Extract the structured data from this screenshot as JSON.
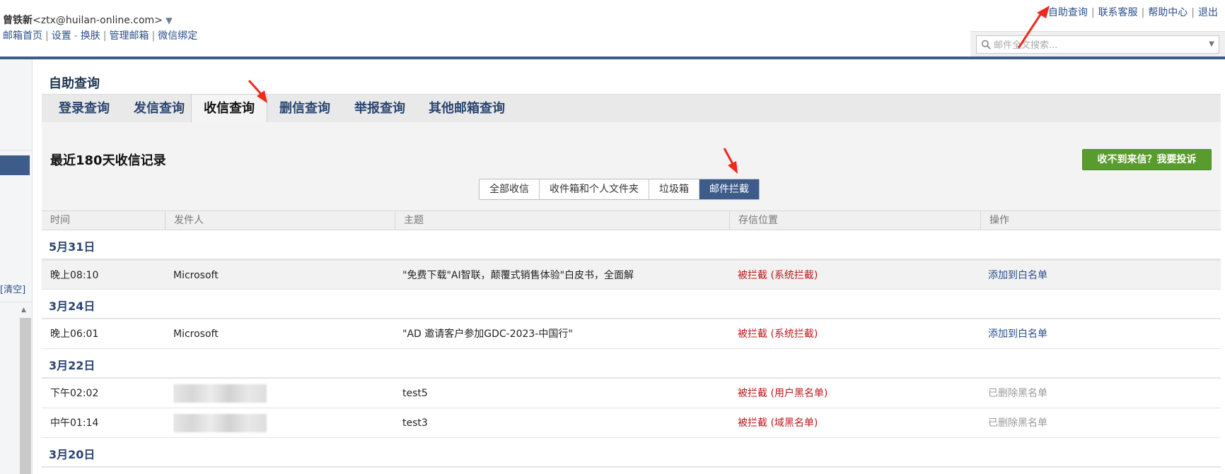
{
  "header": {
    "user_name": "曾铁新",
    "user_email": "<ztx@huilan-online.com>",
    "user_arrow": "▼",
    "links": [
      "邮箱首页",
      "设置",
      "换肤",
      "管理邮箱",
      "微信绑定"
    ],
    "links_seps": [
      "|",
      "-",
      "|",
      "|"
    ],
    "right_links": [
      "自助查询",
      "联系客服",
      "帮助中心",
      "退出"
    ],
    "right_sep": "|",
    "search_placeholder": "邮件全文搜索...",
    "search_caret": "▼"
  },
  "sidebar": {
    "clear_label": "[清空]",
    "scroll_up": "▲"
  },
  "page": {
    "title": "自助查询",
    "tabs": [
      {
        "label": "登录查询",
        "active": false
      },
      {
        "label": "发信查询",
        "active": false
      },
      {
        "label": "收信查询",
        "active": true
      },
      {
        "label": "删信查询",
        "active": false
      },
      {
        "label": "举报查询",
        "active": false
      },
      {
        "label": "其他邮箱查询",
        "active": false
      }
    ],
    "section_title": "最近180天收信记录",
    "complain_button": "收不到来信？我要投诉",
    "filters": [
      {
        "label": "全部收信",
        "active": false
      },
      {
        "label": "收件箱和个人文件夹",
        "active": false
      },
      {
        "label": "垃圾箱",
        "active": false
      },
      {
        "label": "邮件拦截",
        "active": true
      }
    ]
  },
  "table": {
    "columns": [
      "时间",
      "发件人",
      "主题",
      "存信位置",
      "操作"
    ],
    "groups": [
      {
        "date": "5月31日",
        "rows": [
          {
            "time": "晚上08:10",
            "sender": "Microsoft",
            "subject": "\"免费下载\"AI智联，颠覆式销售体验\"白皮书，全面解",
            "location": "被拦截 (系统拦截)",
            "action": "添加到白名单",
            "action_enabled": true,
            "highlight": true,
            "sender_blurred": false
          }
        ]
      },
      {
        "date": "3月24日",
        "rows": [
          {
            "time": "晚上06:01",
            "sender": "Microsoft",
            "subject": "\"AD 邀请客户参加GDC-2023-中国行\"",
            "location": "被拦截 (系统拦截)",
            "action": "添加到白名单",
            "action_enabled": true,
            "highlight": false,
            "sender_blurred": false
          }
        ]
      },
      {
        "date": "3月22日",
        "rows": [
          {
            "time": "下午02:02",
            "sender": "",
            "subject": "test5",
            "location": "被拦截 (用户黑名单)",
            "action": "已删除黑名单",
            "action_enabled": false,
            "highlight": false,
            "sender_blurred": true
          },
          {
            "time": "中午01:14",
            "sender": "",
            "subject": "test3",
            "location": "被拦截 (域黑名单)",
            "action": "已删除黑名单",
            "action_enabled": false,
            "highlight": false,
            "sender_blurred": true
          }
        ]
      },
      {
        "date": "3月20日",
        "rows": []
      }
    ]
  },
  "colors": {
    "accent": "#3d5c8a",
    "status_red": "#c0161b",
    "complain_green": "#5a9b2d",
    "annotation_arrow": "#f0281e"
  }
}
